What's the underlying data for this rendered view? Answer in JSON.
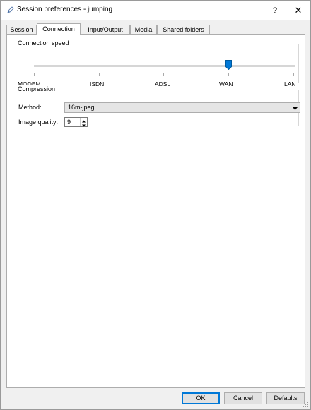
{
  "window": {
    "title": "Session preferences - jumping",
    "help_label": "?",
    "close_label": "✕"
  },
  "tabs": [
    {
      "label": "Session",
      "active": false
    },
    {
      "label": "Connection",
      "active": true
    },
    {
      "label": "Input/Output",
      "active": false
    },
    {
      "label": "Media",
      "active": false
    },
    {
      "label": "Shared folders",
      "active": false
    }
  ],
  "connection_speed": {
    "title": "Connection speed",
    "levels": [
      "MODEM",
      "ISDN",
      "ADSL",
      "WAN",
      "LAN"
    ],
    "selected": "WAN",
    "selected_index": 3
  },
  "compression": {
    "title": "Compression",
    "method_label": "Method:",
    "method_value": "16m-jpeg",
    "quality_label": "Image quality:",
    "quality_value": "9"
  },
  "buttons": {
    "ok": "OK",
    "cancel": "Cancel",
    "defaults": "Defaults"
  },
  "colors": {
    "accent": "#0078d7",
    "window_bg": "#f0f0f0",
    "panel_bg": "#ffffff"
  },
  "icons": {
    "app": "pen-icon",
    "help": "help-icon",
    "close": "close-icon"
  }
}
